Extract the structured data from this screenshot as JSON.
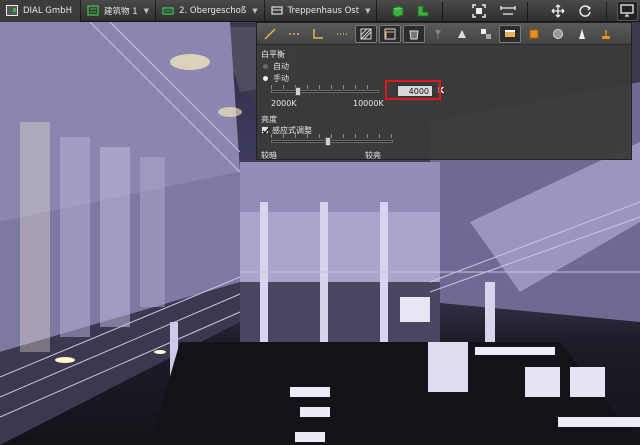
{
  "toolbar": {
    "project": "DIAL GmbH",
    "building": "建筑物 1",
    "floor": "2. Obergeschoß",
    "room": "Treppenhaus Ost",
    "icons": [
      "project-icon",
      "building-icon",
      "floor-icon",
      "room-icon",
      "cube-icon",
      "floorplan-icon",
      "fit-view-icon",
      "measure-icon",
      "move-icon",
      "rotate-icon",
      "monitor-icon"
    ]
  },
  "panel": {
    "white_balance_heading": "白平衡",
    "mode_auto": "自动",
    "mode_manual": "手动",
    "kelvin_value": "4000",
    "kelvin_unit": "K",
    "kelvin_min": "2000K",
    "kelvin_max": "10000K",
    "kelvin_slider_fraction": 0.25,
    "brightness_heading": "亮度",
    "adaptive_label": "感应式调整",
    "adaptive_checked": true,
    "darker_label": "较暗",
    "brighter_label": "较亮",
    "brightness_slider_fraction": 0.47,
    "tool_icons": [
      "line-tool-icon",
      "dashed-line-icon",
      "corner-icon",
      "dotted-icon",
      "hatch-icon",
      "hatch-alt-icon",
      "bucket-icon",
      "lamp-icon",
      "cone-light-icon",
      "quad-icon",
      "display-icon",
      "orange-box-icon",
      "sphere-icon",
      "spot-icon",
      "floor-lamp-icon"
    ]
  },
  "colors": {
    "accent_green": "#3cb043",
    "highlight_red": "#e0161c",
    "toolbar_bg": "#3a3a3a"
  }
}
